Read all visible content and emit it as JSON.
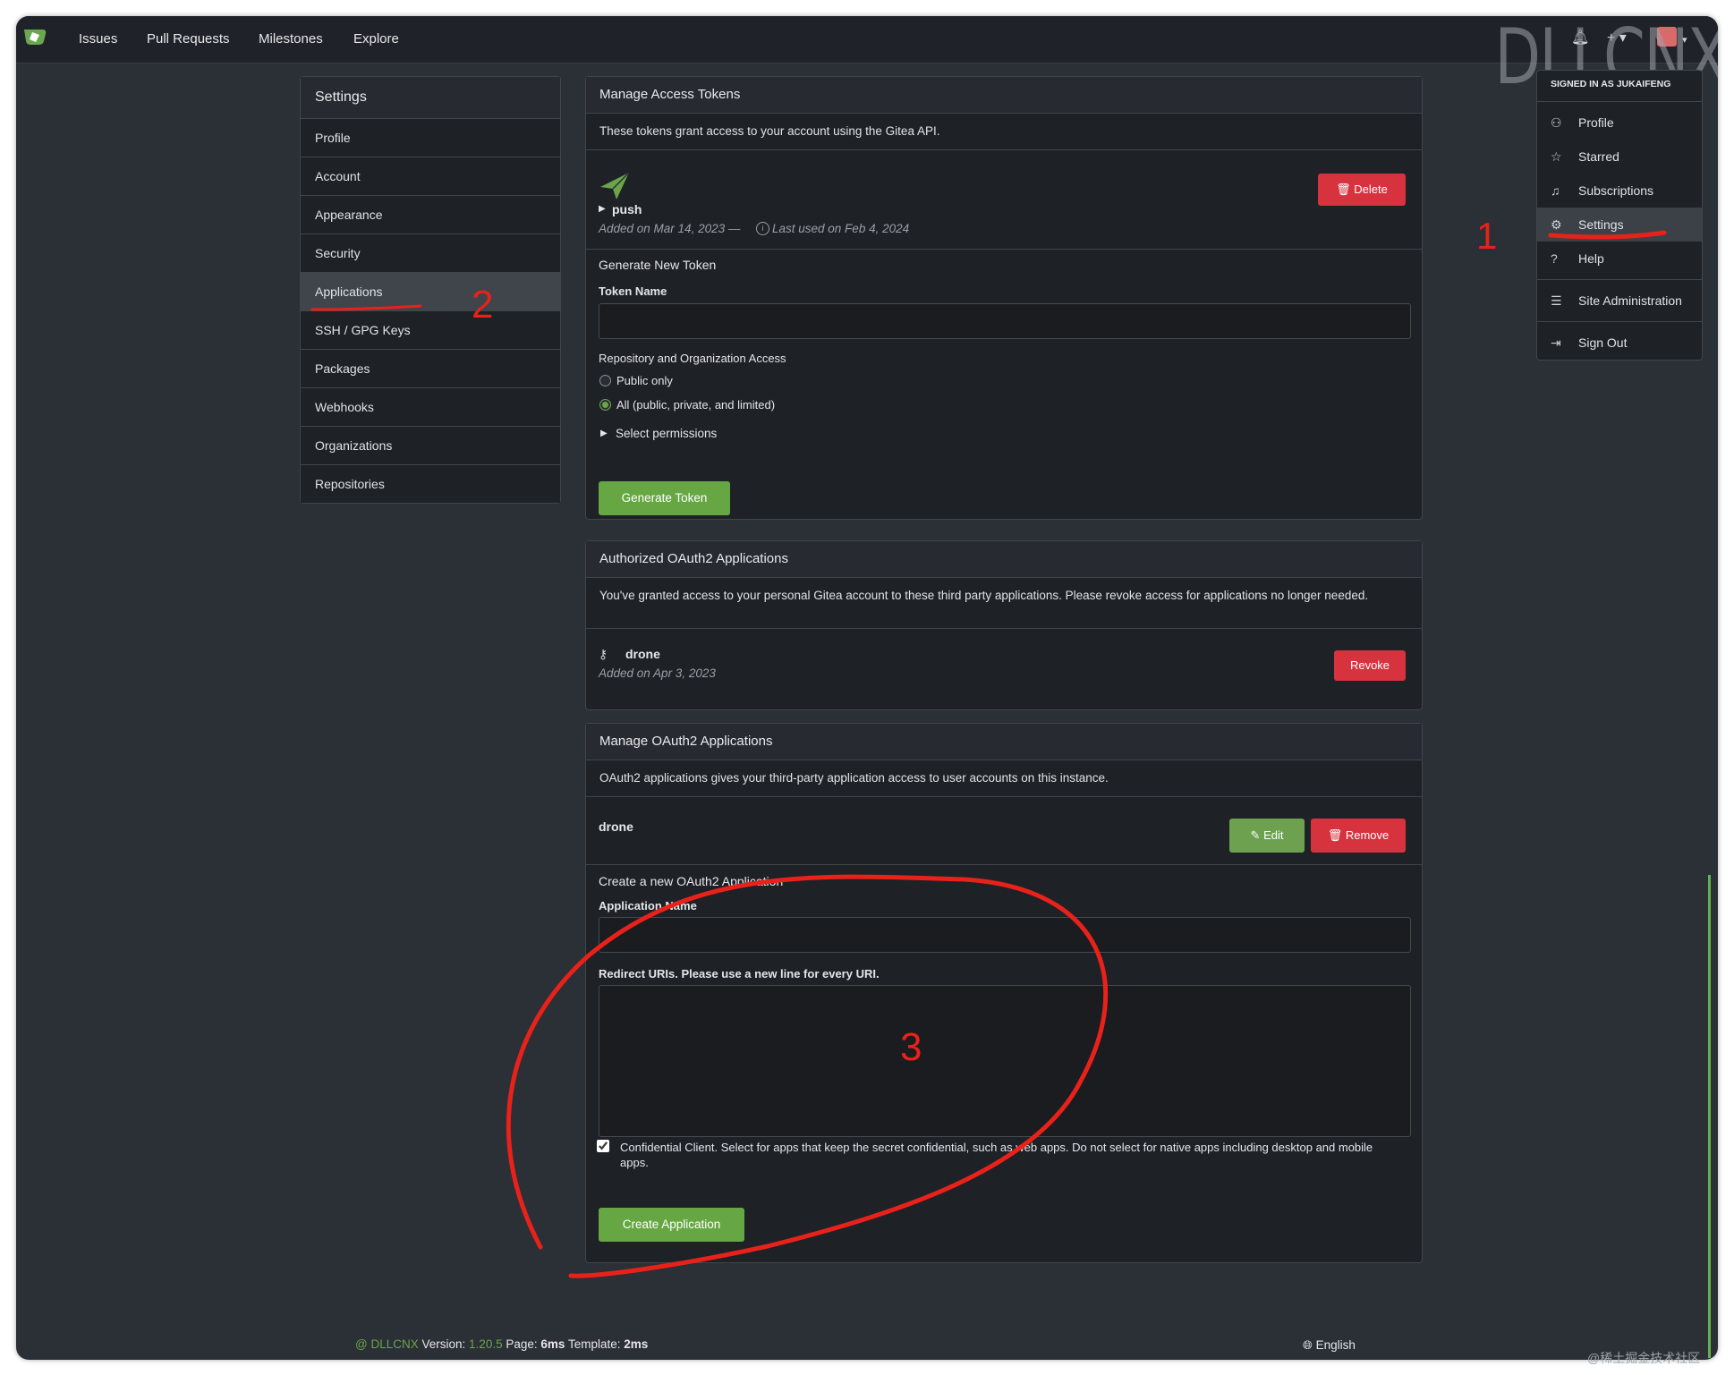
{
  "nav": {
    "links": [
      "Issues",
      "Pull Requests",
      "Milestones",
      "Explore"
    ],
    "watermark": "DLLCNX"
  },
  "sidebar": {
    "title": "Settings",
    "items": [
      {
        "label": "Profile"
      },
      {
        "label": "Account"
      },
      {
        "label": "Appearance"
      },
      {
        "label": "Security"
      },
      {
        "label": "Applications"
      },
      {
        "label": "SSH / GPG Keys"
      },
      {
        "label": "Packages"
      },
      {
        "label": "Webhooks"
      },
      {
        "label": "Organizations"
      },
      {
        "label": "Repositories"
      }
    ]
  },
  "tokens": {
    "title": "Manage Access Tokens",
    "description": "These tokens grant access to your account using the Gitea API.",
    "token_name": "push",
    "token_added": "Added on Mar 14, 2023 —",
    "token_last_used": "Last used on Feb 4, 2024",
    "delete_label": "Delete",
    "generate_title": "Generate New Token",
    "token_name_label": "Token Name",
    "token_name_value": "",
    "access_label": "Repository and Organization Access",
    "option_public": "Public only",
    "option_all": "All (public, private, and limited)",
    "select_permissions": "Select permissions",
    "generate_button": "Generate Token"
  },
  "authorized": {
    "title": "Authorized OAuth2 Applications",
    "description": "You've granted access to your personal Gitea account to these third party applications. Please revoke access for applications no longer needed.",
    "app_name": "drone",
    "app_added": "Added on Apr 3, 2023",
    "revoke_label": "Revoke"
  },
  "oauth_manage": {
    "title": "Manage OAuth2 Applications",
    "description": "OAuth2 applications gives your third-party application access to user accounts on this instance.",
    "app_name": "drone",
    "edit_label": "Edit",
    "remove_label": "Remove",
    "create_title": "Create a new OAuth2 Application",
    "app_name_label": "Application Name",
    "app_name_value": "",
    "redirect_label": "Redirect URIs. Please use a new line for every URI.",
    "redirect_value": "",
    "confidential_label": "Confidential Client. Select for apps that keep the secret confidential, such as web apps. Do not select for native apps including desktop and mobile apps.",
    "confidential_checked": true,
    "create_button": "Create Application"
  },
  "user_menu": {
    "header": "SIGNED IN AS JUKAIFENG",
    "items": [
      {
        "label": "Profile",
        "icon": "person-icon"
      },
      {
        "label": "Starred",
        "icon": "star-icon"
      },
      {
        "label": "Subscriptions",
        "icon": "bell-icon"
      },
      {
        "label": "Settings",
        "icon": "tools-icon"
      },
      {
        "label": "Help",
        "icon": "question-icon"
      },
      {
        "label": "Site Administration",
        "icon": "server-icon"
      },
      {
        "label": "Sign Out",
        "icon": "sign-out-icon"
      }
    ]
  },
  "footer": {
    "powered": "@ DLLCNX",
    "version_label": "Version:",
    "version": "1.20.5",
    "page_label": "Page:",
    "page_time": "6ms",
    "template_label": "Template:",
    "template_time": "2ms",
    "language": "English"
  },
  "annotations": {
    "one": "1",
    "two": "2",
    "three": "3"
  },
  "corner_watermark": "@稀土掘金技术社区",
  "colors": {
    "accent_green": "#66a743",
    "danger_red": "#d6333f",
    "annotation_red": "#e8221a"
  }
}
